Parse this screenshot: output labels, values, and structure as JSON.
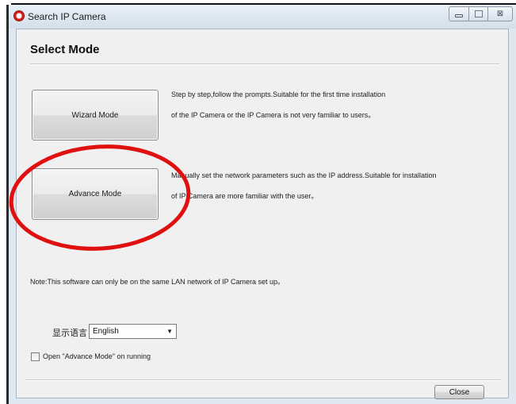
{
  "window": {
    "title": "Search IP Camera",
    "controls": {
      "minimize_icon": "minimize-icon",
      "maximize_icon": "maximize-icon",
      "close_glyph": "⊠"
    }
  },
  "page": {
    "heading": "Select Mode"
  },
  "wizard": {
    "label": "Wizard Mode",
    "desc_line1": "Step by step,follow the prompts.Suitable for the first time installation",
    "desc_line2": "of the IP Camera or the IP Camera is not very familiar to users。"
  },
  "advance": {
    "label": "Advance Mode",
    "desc_line1": "Manually set the network parameters such as the IP address.Suitable for installation",
    "desc_line2": "of IP Camera are more familiar with the user。"
  },
  "note": "Note:This software can only be on the same LAN network of IP Camera set up。",
  "language": {
    "label": "显示语言",
    "value": "English",
    "arrow": "▼"
  },
  "startup": {
    "label": "Open \"Advance Mode\" on running",
    "checked": false
  },
  "footer": {
    "close_label": "Close"
  },
  "colors": {
    "annotation": "#e01010",
    "accent_titlebar": "#dfe8f1"
  }
}
